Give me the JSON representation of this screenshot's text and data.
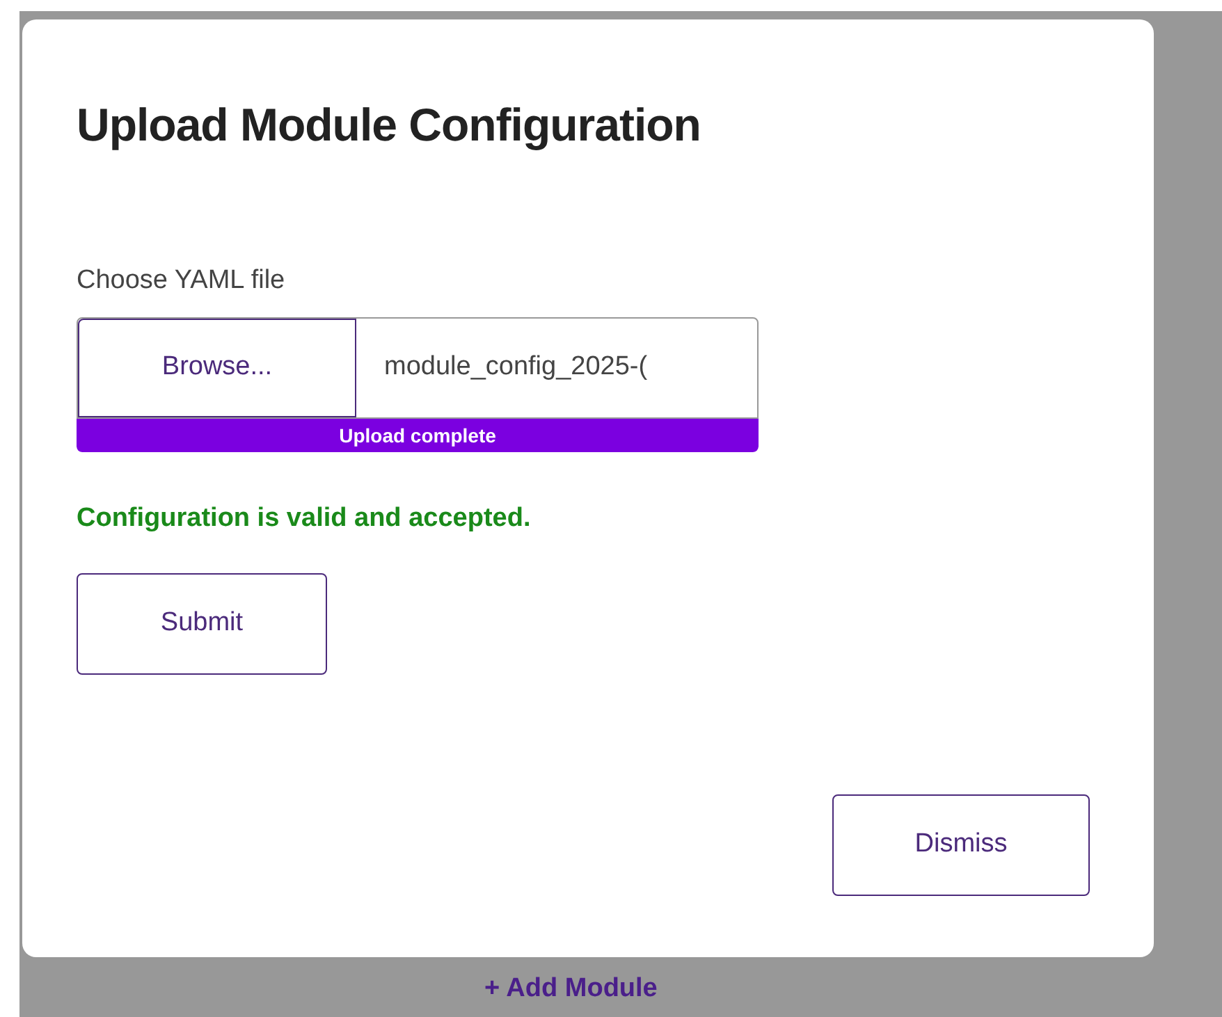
{
  "background": {
    "link": "+ Add Module"
  },
  "dialog": {
    "title": "Upload Module Configuration",
    "file_field": {
      "label": "Choose YAML file",
      "button": "Browse...",
      "value": "module_config_2025-("
    },
    "upload": {
      "level": 1,
      "label": "Upload complete"
    },
    "message": "Configuration is valid and accepted.",
    "submit": "Submit",
    "dismiss": "Dismiss"
  }
}
